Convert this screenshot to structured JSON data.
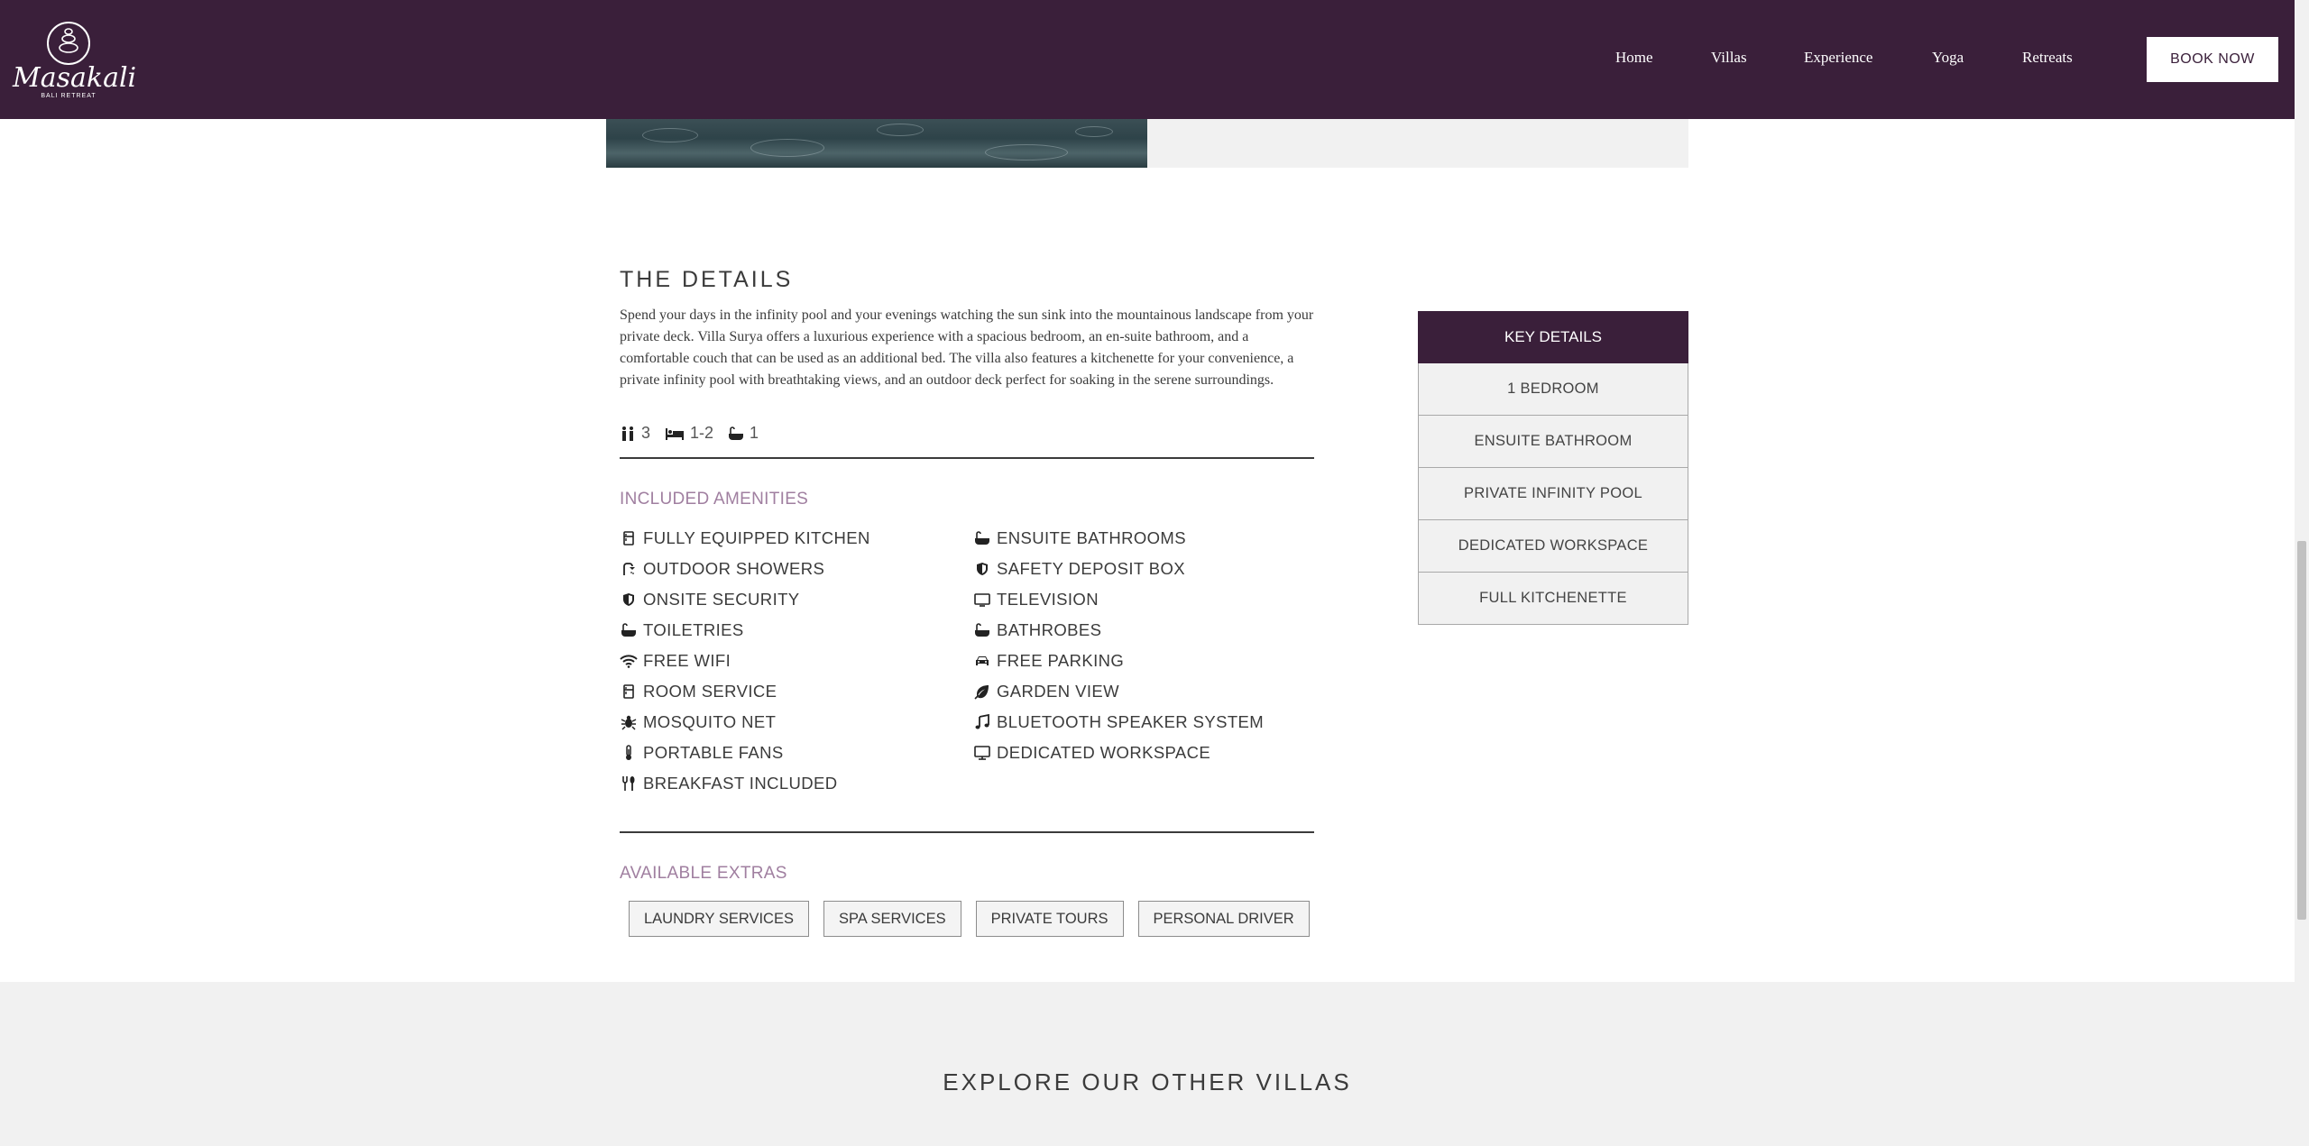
{
  "brand": {
    "name": "Masakali",
    "tagline": "BALI RETREAT"
  },
  "nav": {
    "items": [
      "Home",
      "Villas",
      "Experience",
      "Yoga",
      "Retreats"
    ],
    "book_label": "BOOK NOW"
  },
  "details": {
    "title": "THE DETAILS",
    "description": "Spend your days in the infinity pool and your evenings watching the sun sink into the mountainous landscape from your private deck. Villa Surya offers a luxurious experience with a spacious bedroom, an en-suite bathroom, and a comfortable couch that can be used as an additional bed. The villa also features a kitchenette for your convenience, a private infinity pool with breathtaking views, and an outdoor deck perfect for soaking in the serene surroundings.",
    "guests": "3",
    "beds": "1-2",
    "baths": "1"
  },
  "amenities": {
    "label": "INCLUDED AMENITIES",
    "left": [
      {
        "label": "FULLY EQUIPPED KITCHEN",
        "icon": "fridge-icon"
      },
      {
        "label": "OUTDOOR SHOWERS",
        "icon": "shower-icon"
      },
      {
        "label": "ONSITE SECURITY",
        "icon": "shield-icon"
      },
      {
        "label": "TOILETRIES",
        "icon": "bath-icon"
      },
      {
        "label": "FREE WIFI",
        "icon": "wifi-icon"
      },
      {
        "label": "ROOM SERVICE",
        "icon": "fridge-icon"
      },
      {
        "label": "MOSQUITO NET",
        "icon": "bug-icon"
      },
      {
        "label": "PORTABLE FANS",
        "icon": "thermometer-icon"
      },
      {
        "label": "BREAKFAST INCLUDED",
        "icon": "utensils-icon"
      }
    ],
    "right": [
      {
        "label": "ENSUITE BATHROOMS",
        "icon": "bath-icon"
      },
      {
        "label": "SAFETY DEPOSIT BOX",
        "icon": "shield-icon"
      },
      {
        "label": "TELEVISION",
        "icon": "tv-icon"
      },
      {
        "label": "BATHROBES",
        "icon": "bath-icon"
      },
      {
        "label": "FREE PARKING",
        "icon": "car-icon"
      },
      {
        "label": "GARDEN VIEW",
        "icon": "leaf-icon"
      },
      {
        "label": "BLUETOOTH SPEAKER SYSTEM",
        "icon": "music-icon"
      },
      {
        "label": "DEDICATED WORKSPACE",
        "icon": "desktop-icon"
      }
    ]
  },
  "extras": {
    "label": "AVAILABLE EXTRAS",
    "items": [
      "LAUNDRY SERVICES",
      "SPA SERVICES",
      "PRIVATE TOURS",
      "PERSONAL DRIVER"
    ]
  },
  "key_details": {
    "title": "KEY DETAILS",
    "items": [
      "1 BEDROOM",
      "ENSUITE BATHROOM",
      "PRIVATE INFINITY POOL",
      "DEDICATED WORKSPACE",
      "FULL KITCHENETTE"
    ]
  },
  "explore": {
    "title": "EXPLORE OUR OTHER VILLAS"
  },
  "colors": {
    "brand": "#3a1f3a",
    "accent": "#a07fa0",
    "panel": "#f1f1f1"
  }
}
